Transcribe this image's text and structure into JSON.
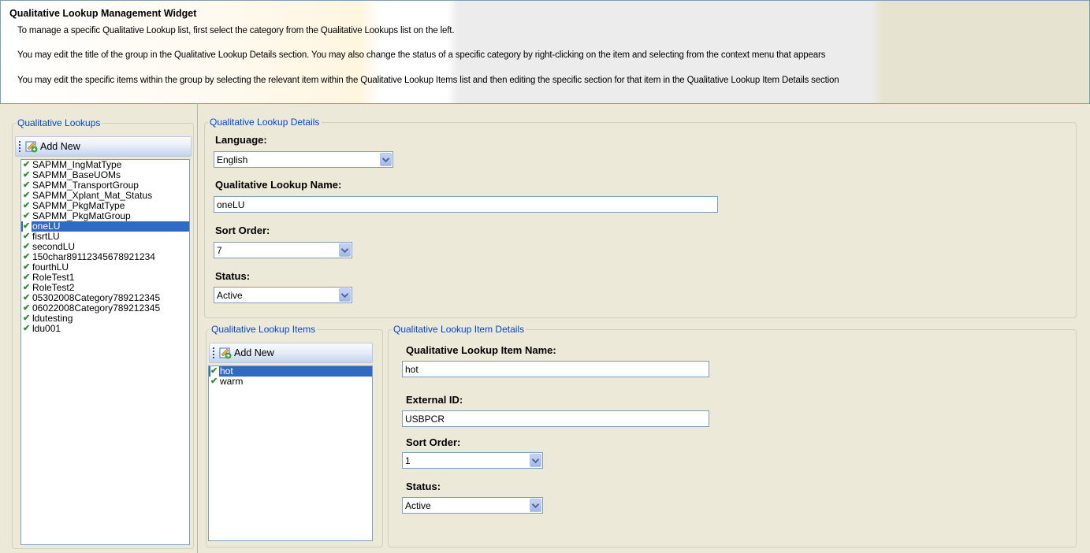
{
  "header": {
    "title": "Qualitative Lookup Management Widget",
    "lines": [
      "To manage a specific Qualitative Lookup list, first select the category from the Qualitative Lookups list on the left.",
      "You may edit the title of the group in the Qualitative Lookup Details section. You may also change the status of a specific category by right-clicking on the item and selecting from the context menu that appears",
      "You may edit the specific items within the group by selecting the relevant item within the Qualitative Lookup Items list and then editing the specific section for that item in the Qualitative Lookup Item Details section"
    ]
  },
  "lookups": {
    "legend": "Qualitative Lookups",
    "add_label": "Add New",
    "items": [
      "SAPMM_IngMatType",
      "SAPMM_BaseUOMs",
      "SAPMM_TransportGroup",
      "SAPMM_Xplant_Mat_Status",
      "SAPMM_PkgMatType",
      "SAPMM_PkgMatGroup",
      "oneLU",
      "fisrtLU",
      "secondLU",
      "150char89112345678921234",
      "fourthLU",
      "RoleTest1",
      "RoleTest2",
      "05302008Category789212345",
      "06022008Category789212345",
      "ldutesting",
      "ldu001"
    ],
    "selected": "oneLU"
  },
  "details": {
    "legend": "Qualitative Lookup Details",
    "language_label": "Language:",
    "language_value": "English",
    "name_label": "Qualitative Lookup Name:",
    "name_value": "oneLU",
    "sort_label": "Sort Order:",
    "sort_value": "7",
    "status_label": "Status:",
    "status_value": "Active"
  },
  "items": {
    "legend": "Qualitative Lookup Items",
    "add_label": "Add New",
    "list": [
      "hot",
      "warm"
    ],
    "selected": "hot"
  },
  "item_details": {
    "legend": "Qualitative Lookup Item Details",
    "name_label": "Qualitative Lookup Item Name:",
    "name_value": "hot",
    "external_label": "External ID:",
    "external_value": "USBPCR",
    "sort_label": "Sort Order:",
    "sort_value": "1",
    "status_label": "Status:",
    "status_value": "Active"
  },
  "colors": {
    "selection": "#316ac5",
    "legend_text": "#0046d5",
    "check": "#2e8b2e"
  }
}
